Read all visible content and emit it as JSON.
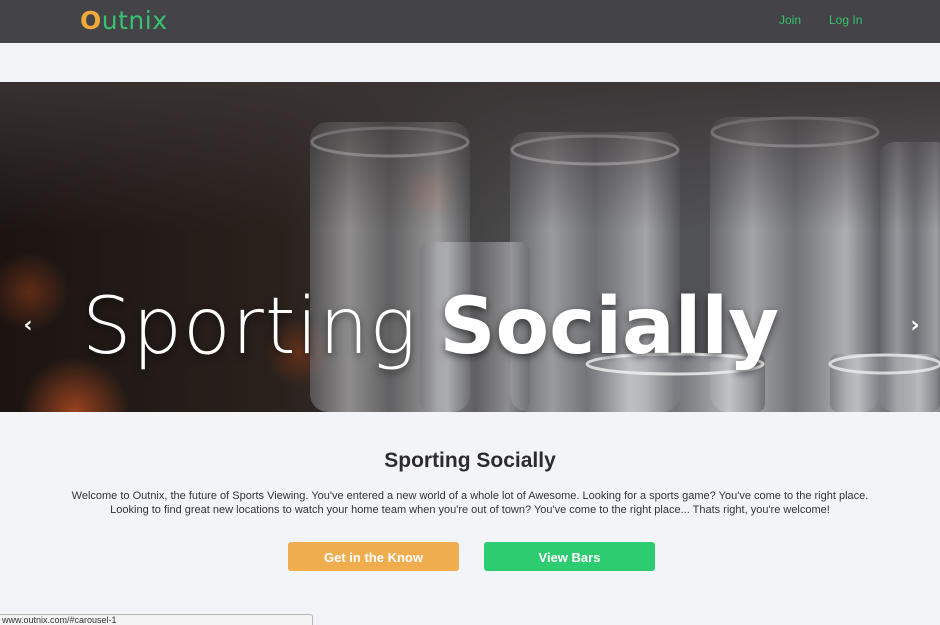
{
  "navbar": {
    "logo_first": "O",
    "logo_rest": "utnix",
    "join_label": "Join",
    "login_label": "Log In",
    "background": "#444348",
    "link_color": "#37c26f",
    "logo_accent": "#f0a93b"
  },
  "carousel": {
    "caption_light": "Sporting",
    "caption_bold": "Socially",
    "prev_icon": "chevron-left-icon",
    "next_icon": "chevron-right-icon",
    "prev_glyph": "‹",
    "next_glyph": "›"
  },
  "main": {
    "title": "Sporting Socially",
    "intro": "Welcome to Outnix, the future of Sports Viewing. You've entered a new world of a whole lot of Awesome. Looking for a sports game? You've come to the right place. Looking to find great new locations to watch your home team when you're out of town? You've come to the right place... Thats right, you're welcome!",
    "buttons": {
      "know_label": "Get in the Know",
      "bars_label": "View Bars",
      "know_color": "#f0ad4e",
      "bars_color": "#2ecc71"
    }
  },
  "status_bar": {
    "url": "www.outnix.com/#carousel-1"
  }
}
